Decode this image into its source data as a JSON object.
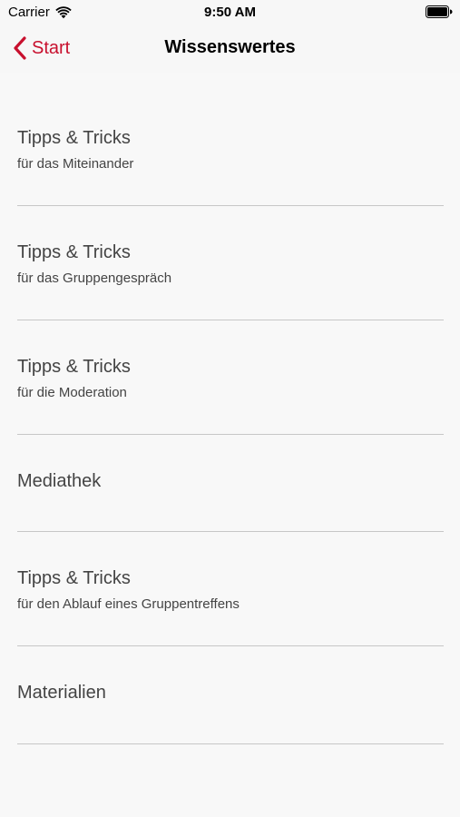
{
  "status_bar": {
    "carrier": "Carrier",
    "time": "9:50 AM",
    "wifi_icon": "wifi-icon",
    "battery_icon": "battery-icon"
  },
  "nav_bar": {
    "back_label": "Start",
    "back_icon": "chevron-left-icon",
    "title": "Wissenswertes",
    "accent_color": "#c8102e"
  },
  "list": {
    "items": [
      {
        "title": "Tipps & Tricks",
        "subtitle": "für das Miteinander"
      },
      {
        "title": "Tipps & Tricks",
        "subtitle": "für das Gruppengespräch"
      },
      {
        "title": "Tipps & Tricks",
        "subtitle": "für die Moderation"
      },
      {
        "title": "Mediathek",
        "subtitle": ""
      },
      {
        "title": "Tipps & Tricks",
        "subtitle": "für den Ablauf eines Gruppentreffens"
      },
      {
        "title": "Materialien",
        "subtitle": ""
      }
    ]
  }
}
